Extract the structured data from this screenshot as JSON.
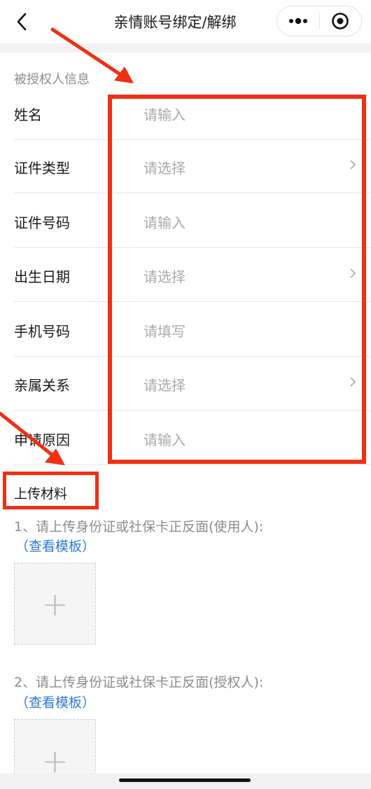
{
  "navbar": {
    "title": "亲情账号绑定/解绑",
    "back_icon": "chevron-left-icon",
    "more_icon": "more-dots-icon",
    "close_icon": "target-circle-icon"
  },
  "authorized_section": {
    "title": "被授权人信息",
    "rows": [
      {
        "label": "姓名",
        "value": "请输入",
        "arrow": false
      },
      {
        "label": "证件类型",
        "value": "请选择",
        "arrow": true
      },
      {
        "label": "证件号码",
        "value": "请输入",
        "arrow": false
      },
      {
        "label": "出生日期",
        "value": "请选择",
        "arrow": true
      },
      {
        "label": "手机号码",
        "value": "请填写",
        "arrow": false
      },
      {
        "label": "亲属关系",
        "value": "请选择",
        "arrow": true
      },
      {
        "label": "申请原因",
        "value": "请输入",
        "arrow": false
      }
    ]
  },
  "upload_section": {
    "title": "上传材料",
    "items": [
      {
        "text": "1、请上传身份证或社保卡正反面(使用人):",
        "link": "（查看模板）",
        "add_icon": "plus-icon"
      },
      {
        "text": "2、请上传身份证或社保卡正反面(授权人):",
        "link": "（查看模板）",
        "add_icon": "plus-icon"
      }
    ]
  },
  "annotation_color": "#ee3014",
  "link_color": "#2d7ad6"
}
